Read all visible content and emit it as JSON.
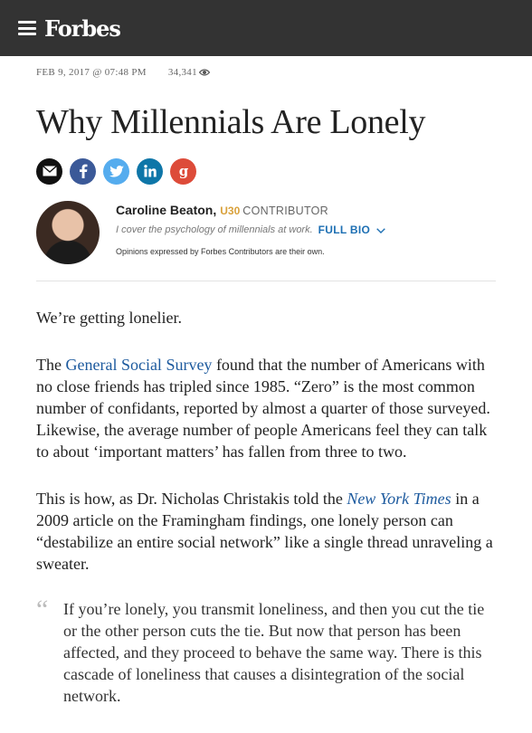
{
  "header": {
    "logo": "Forbes",
    "menu_icon": "hamburger-menu-icon"
  },
  "meta": {
    "date": "FEB 9, 2017 @ 07:48 PM",
    "views": "34,341",
    "views_icon": "eye-icon"
  },
  "title": "Why Millennials Are Lonely",
  "share": [
    {
      "name": "email-icon",
      "color": "#111111"
    },
    {
      "name": "facebook-icon",
      "color": "#3b5998"
    },
    {
      "name": "twitter-icon",
      "color": "#55acee"
    },
    {
      "name": "linkedin-icon",
      "color": "#0e76a8"
    },
    {
      "name": "google-plus-icon",
      "color": "#dd4b39"
    }
  ],
  "author": {
    "name": "Caroline Beaton,",
    "badge": "U30",
    "role": "CONTRIBUTOR",
    "tagline": "I cover the psychology of millennials at work.",
    "full_bio": "FULL BIO",
    "disclaimer": "Opinions expressed by Forbes Contributors are their own."
  },
  "body": {
    "p1": "We’re getting lonelier.",
    "p2_pre": "The ",
    "p2_link": "General Social Survey",
    "p2_post": " found that the number of Americans with no close friends has tripled since 1985. “Zero” is the most common number of confidants, reported by almost a quarter of those surveyed. Likewise, the average number of people Americans feel they can talk to about ‘important matters’ has fallen from three to two.",
    "p3_pre": "This is how, as Dr. Nicholas Christakis told the ",
    "p3_link": "New York Times",
    "p3_post": " in a 2009 article on the Framingham findings, one lonely person can “destabilize an entire social network” like a single thread unraveling a sweater.",
    "quote_mark": "“",
    "quote": "If you’re lonely, you transmit loneliness, and then you cut the tie or the other person cuts the tie. But now that person has been affected, and they proceed to behave the same way. There is this cascade of loneliness that causes a disintegration of the social network."
  },
  "colors": {
    "topbar": "#333333",
    "link": "#1d5a9e",
    "full_bio": "#1d6fb3",
    "badge": "#d9a13b"
  }
}
